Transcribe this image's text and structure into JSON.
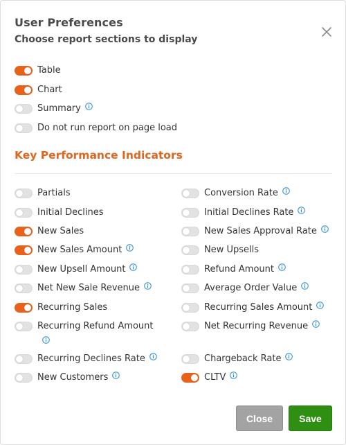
{
  "dialog": {
    "title": "User Preferences",
    "subtitle": "Choose report sections to display"
  },
  "sections": [
    {
      "label": "Table",
      "on": true,
      "info": false
    },
    {
      "label": "Chart",
      "on": true,
      "info": false
    },
    {
      "label": "Summary",
      "on": false,
      "info": true
    },
    {
      "label": "Do not run report on page load",
      "on": false,
      "info": false
    }
  ],
  "kpi": {
    "title": "Key Performance Indicators",
    "left": [
      {
        "label": "Partials",
        "on": false,
        "info": false
      },
      {
        "label": "Initial Declines",
        "on": false,
        "info": false
      },
      {
        "label": "New Sales",
        "on": true,
        "info": false
      },
      {
        "label": "New Sales Amount",
        "on": true,
        "info": true
      },
      {
        "label": "New Upsell Amount",
        "on": false,
        "info": true
      },
      {
        "label": "Net New Sale Revenue",
        "on": false,
        "info": true
      },
      {
        "label": "Recurring Sales",
        "on": true,
        "info": false
      },
      {
        "label": "Recurring Refund Amount",
        "on": false,
        "info": true
      },
      {
        "label": "Recurring Declines Rate",
        "on": false,
        "info": true
      },
      {
        "label": "New Customers",
        "on": false,
        "info": true
      }
    ],
    "right": [
      {
        "label": "Conversion Rate",
        "on": false,
        "info": true
      },
      {
        "label": "Initial Declines Rate",
        "on": false,
        "info": true
      },
      {
        "label": "New Sales Approval Rate",
        "on": false,
        "info": true
      },
      {
        "label": "New Upsells",
        "on": false,
        "info": false
      },
      {
        "label": "Refund Amount",
        "on": false,
        "info": true
      },
      {
        "label": "Average Order Value",
        "on": false,
        "info": true
      },
      {
        "label": "Recurring Sales Amount",
        "on": false,
        "info": true
      },
      {
        "label": "Net Recurring Revenue",
        "on": false,
        "info": true
      },
      {
        "label": "Chargeback Rate",
        "on": false,
        "info": true
      },
      {
        "label": "CLTV",
        "on": true,
        "info": true
      }
    ]
  },
  "footer": {
    "close_label": "Close",
    "save_label": "Save"
  },
  "colors": {
    "accent": "#e8621c",
    "info_icon": "#2a8ad4",
    "save": "#2f8f12",
    "close": "#a3a3a3"
  },
  "icons": {
    "close": "close-icon",
    "info": "info-icon"
  }
}
